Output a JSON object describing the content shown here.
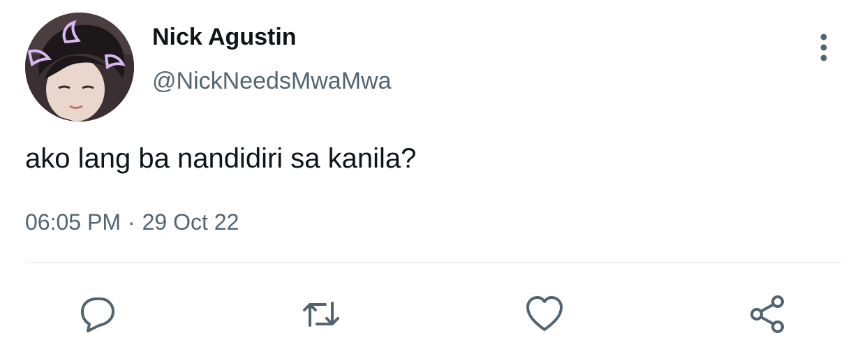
{
  "author": {
    "display_name": "Nick Agustin",
    "handle": "@NickNeedsMwaMwa"
  },
  "tweet": {
    "text": "ako lang ba nandidiri sa kanila?",
    "time": "06:05 PM",
    "separator": "·",
    "date": "29 Oct 22"
  },
  "actions": {
    "reply_icon": "comment-icon",
    "retweet_icon": "retweet-icon",
    "like_icon": "heart-icon",
    "share_icon": "share-icon",
    "more_icon": "more-vertical-icon"
  },
  "colors": {
    "text_primary": "#0f1419",
    "text_secondary": "#536471",
    "icon": "#536471",
    "divider": "#eff3f4"
  }
}
